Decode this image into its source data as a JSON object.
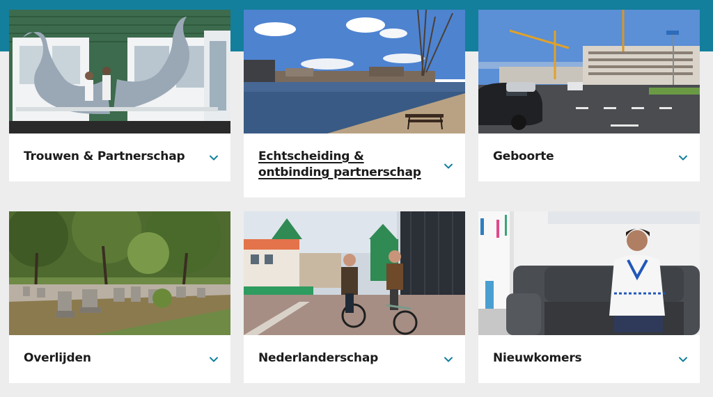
{
  "accent_color": "#137f9c",
  "chevron_icon": "chevron-down-icon",
  "cards": [
    {
      "title": "Trouwen & Partnerschap",
      "image_alt": "Wedding couple on balcony with whale sculptures"
    },
    {
      "title": "Echtscheiding & ontbinding partnerschap",
      "image_alt": "Canal with bench and city skyline"
    },
    {
      "title": "Geboorte",
      "image_alt": "Street crossing with construction cranes"
    },
    {
      "title": "Overlijden",
      "image_alt": "Cemetery with trees"
    },
    {
      "title": "Nederlanderschap",
      "image_alt": "Two people cycling past green houses"
    },
    {
      "title": "Nieuwkomers",
      "image_alt": "Woman smiling on grey sofa"
    }
  ]
}
